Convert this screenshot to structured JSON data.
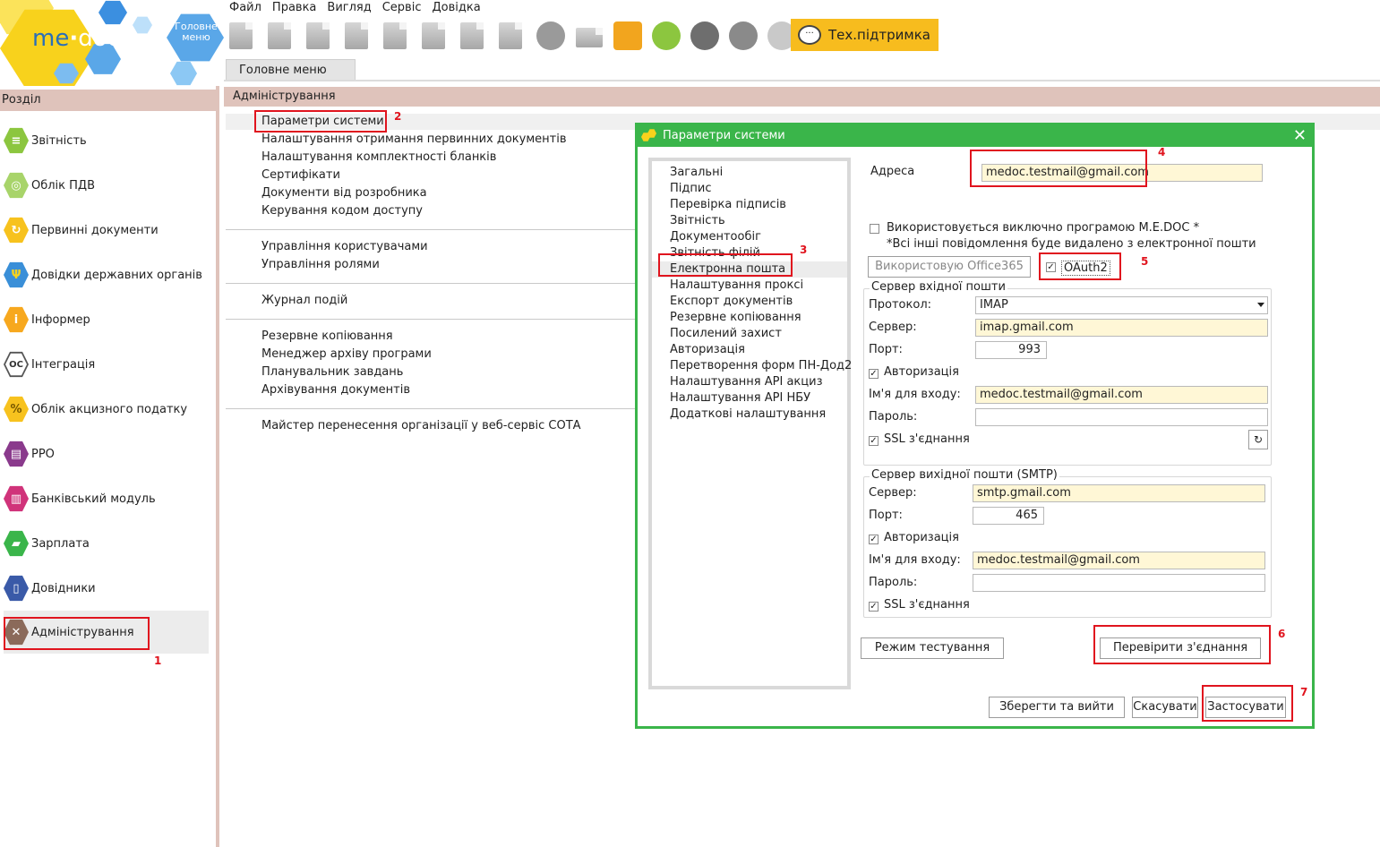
{
  "menu": [
    "Файл",
    "Правка",
    "Вигляд",
    "Сервіс",
    "Довідка"
  ],
  "logo": {
    "text_me": "me",
    "text_doc": "doc",
    "home_label": "Головне меню"
  },
  "toolbar": {
    "support_label": "Тех.підтримка"
  },
  "tabs": {
    "main": "Головне меню"
  },
  "sidebar": {
    "header": "Розділ",
    "items": [
      {
        "label": "Звітність",
        "icon": "reports-icon",
        "color": "#8cc63f"
      },
      {
        "label": "Облік ПДВ",
        "icon": "vat-icon",
        "color": "#8cc63f"
      },
      {
        "label": "Первинні документи",
        "icon": "primary-docs-icon",
        "color": "#f7c21e"
      },
      {
        "label": "Довідки державних органів",
        "icon": "trident-icon",
        "color": "#3a8fd8"
      },
      {
        "label": "Інформер",
        "icon": "info-icon",
        "color": "#f7a81e"
      },
      {
        "label": "Інтеграція",
        "icon": "integration-icon",
        "color": "#ffffff"
      },
      {
        "label": "Облік акцизного податку",
        "icon": "excise-icon",
        "color": "#f7c21e"
      },
      {
        "label": "РРО",
        "icon": "cash-register-icon",
        "color": "#8a3a8c"
      },
      {
        "label": "Банківський модуль",
        "icon": "bank-icon",
        "color": "#d0337a"
      },
      {
        "label": "Зарплата",
        "icon": "salary-icon",
        "color": "#3ab54a"
      },
      {
        "label": "Довідники",
        "icon": "book-icon",
        "color": "#3a5aa8"
      },
      {
        "label": "Адміністрування",
        "icon": "tools-icon",
        "color": "#8b6a5a"
      }
    ]
  },
  "admin": {
    "header": "Адміністрування",
    "links": [
      "Параметри системи",
      "Налаштування отримання первинних документів",
      "Налаштування комплектності бланків",
      "Сертифікати",
      "Документи від розробника",
      "Керування кодом доступу",
      "Управління користувачами",
      "Управління ролями",
      "Журнал подій",
      "Резервне копіювання",
      "Менеджер архіву програми",
      "Планувальник завдань",
      "Архівування документів",
      "Майстер перенесення організації у веб-сервіс СОТА"
    ]
  },
  "annotations": [
    "1",
    "2",
    "3",
    "4",
    "5",
    "6",
    "7"
  ],
  "dialog": {
    "title": "Параметри системи",
    "close": "✕",
    "nav": [
      "Загальні",
      "Підпис",
      "Перевірка підписів",
      "Звітність",
      "Документообіг",
      "Звітність філій",
      "Електронна пошта",
      "Налаштування проксі",
      "Експорт документів",
      "Резервне копіювання",
      "Посилений захист",
      "Авторизація",
      "Перетворення форм ПН-Дод2",
      "Налаштування API акциз",
      "Налаштування API НБУ",
      "Додаткові налаштування"
    ],
    "address_label": "Адреса",
    "address_value": "medoc.testmail@gmail.com",
    "exclusive_label": "Використовується виключно програмою M.E.DOC *",
    "exclusive_note": "*Всі інші повідомлення буде видалено з електронної пошти",
    "office365_button": "Використовую Office365",
    "oauth_label": "OAuth2",
    "incoming": {
      "title": "Сервер вхідної пошти",
      "protocol_label": "Протокол:",
      "protocol_value": "IMAP",
      "server_label": "Сервер:",
      "server_value": "imap.gmail.com",
      "port_label": "Порт:",
      "port_value": "993",
      "auth_label": "Авторизація",
      "login_label": "Ім'я для входу:",
      "login_value": "medoc.testmail@gmail.com",
      "password_label": "Пароль:",
      "ssl_label": "SSL з'єднання"
    },
    "outgoing": {
      "title": "Сервер вихідної пошти (SMTP)",
      "server_label": "Сервер:",
      "server_value": "smtp.gmail.com",
      "port_label": "Порт:",
      "port_value": "465",
      "auth_label": "Авторизація",
      "login_label": "Ім'я для входу:",
      "login_value": "medoc.testmail@gmail.com",
      "password_label": "Пароль:",
      "ssl_label": "SSL з'єднання"
    },
    "test_mode_button": "Режим тестування",
    "check_connection_button": "Перевірити з'єднання",
    "save_exit_button": "Зберегти та вийти",
    "cancel_button": "Скасувати",
    "apply_button": "Застосувати",
    "check_mark": "✓"
  },
  "colors": {
    "accent_green": "#3ab54a",
    "section_bg": "#dfc3bb",
    "annotation_red": "#e0141e",
    "support_yellow": "#f7bc1e"
  }
}
